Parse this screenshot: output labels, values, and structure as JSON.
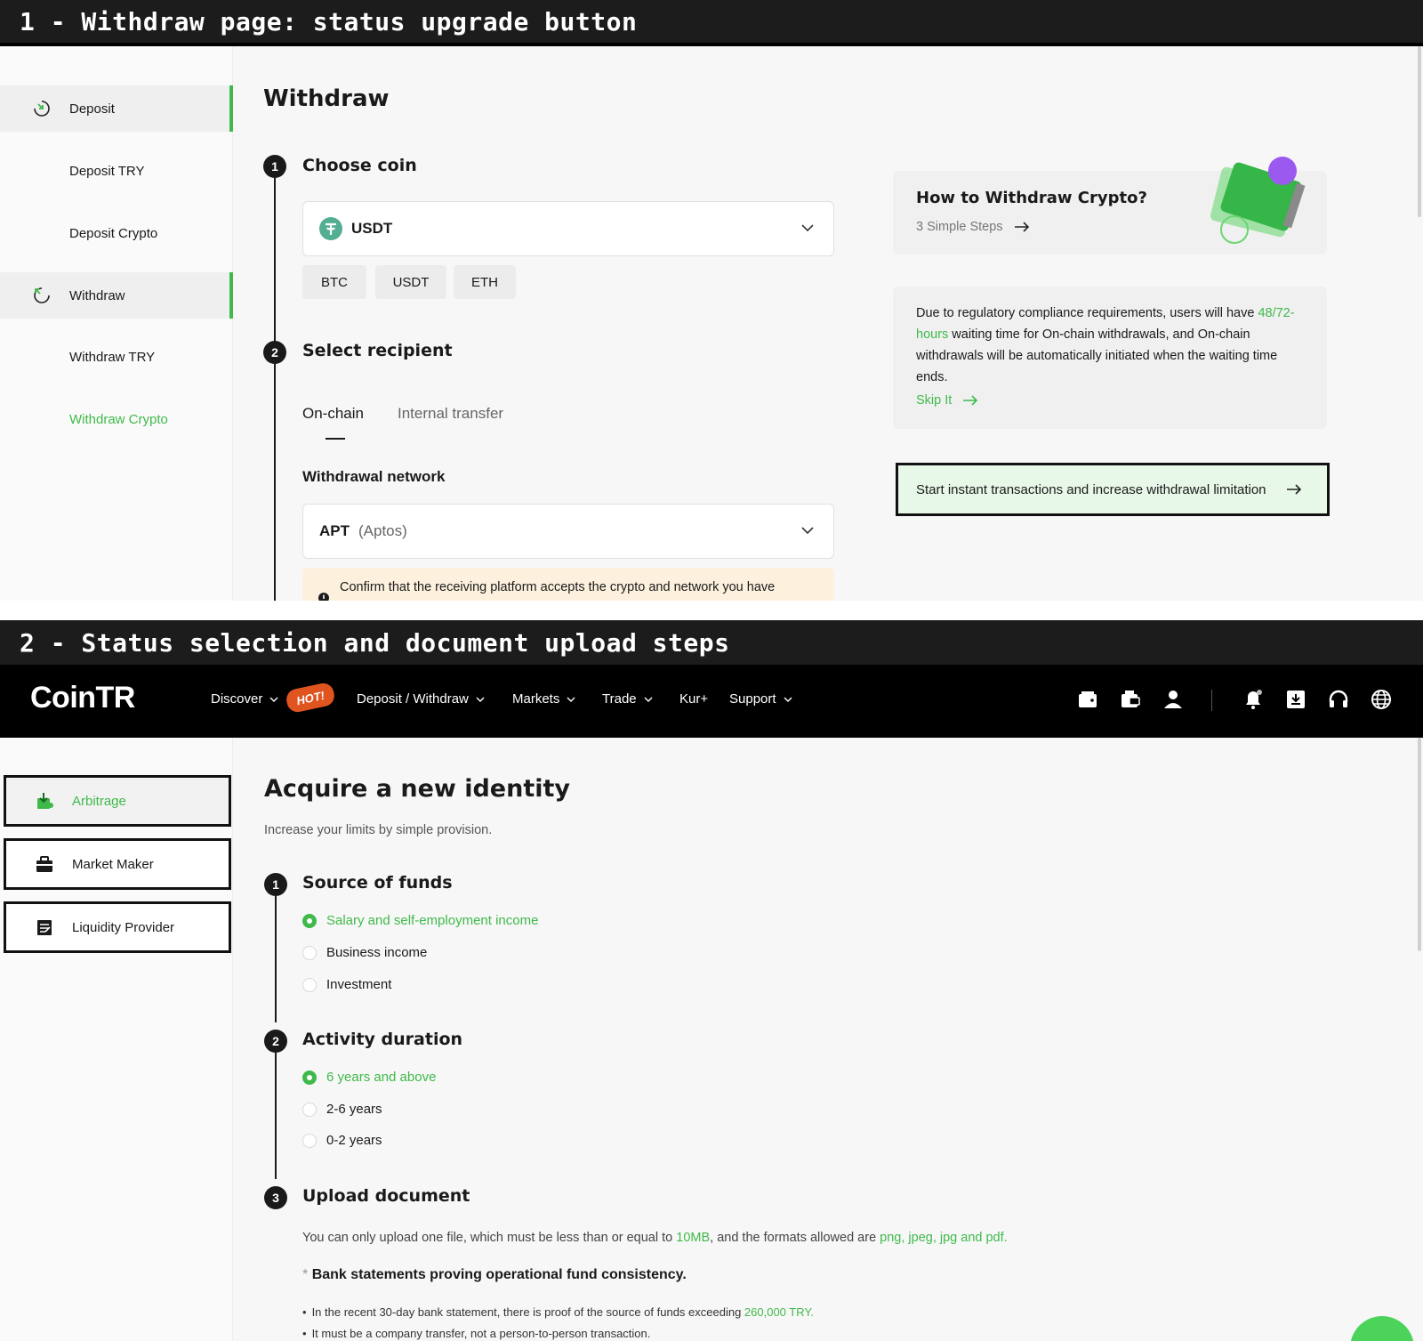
{
  "banners": {
    "one": "1 - Withdraw page: status upgrade button",
    "two": "2 - Status selection and document upload steps"
  },
  "withdraw_page": {
    "sidebar": {
      "deposit": "Deposit",
      "deposit_try": "Deposit TRY",
      "deposit_crypto": "Deposit Crypto",
      "withdraw": "Withdraw",
      "withdraw_try": "Withdraw TRY",
      "withdraw_crypto": "Withdraw Crypto"
    },
    "title": "Withdraw",
    "step1": {
      "num": "1",
      "label": "Choose coin",
      "selected_coin": "USDT",
      "chips": [
        "BTC",
        "USDT",
        "ETH"
      ]
    },
    "step2": {
      "num": "2",
      "label": "Select recipient",
      "tabs": [
        "On-chain",
        "Internal transfer"
      ],
      "network_label": "Withdrawal network",
      "network_code": "APT",
      "network_name": "(Aptos)",
      "notice": "Confirm that the receiving platform accepts the crypto and network you have"
    },
    "howto": {
      "title": "How to Withdraw Crypto?",
      "subtitle": "3 Simple Steps"
    },
    "compliance": {
      "part1": "Due to regulatory compliance requirements, users will have",
      "highlight": "48/72-hours",
      "part2": " waiting time for On-chain withdrawals, and On-chain withdrawals will be automatically initiated when the waiting time ends.",
      "link": "Skip It"
    },
    "promo_button": "Start instant transactions and increase withdrawal limitation"
  },
  "identity_page": {
    "nav": {
      "logo": "CoinTR",
      "discover": "Discover",
      "hot": "HOT!",
      "deposit_withdraw": "Deposit / Withdraw",
      "markets": "Markets",
      "trade": "Trade",
      "kur": "Kur+",
      "support": "Support"
    },
    "roles": [
      "Arbitrage",
      "Market Maker",
      "Liquidity Provider"
    ],
    "title": "Acquire a new identity",
    "subtitle": "Increase your limits by simple provision.",
    "source_of_funds": {
      "num": "1",
      "label": "Source of funds",
      "options": [
        "Salary and self-employment income",
        "Business income",
        "Investment"
      ],
      "selected": 0
    },
    "activity_duration": {
      "num": "2",
      "label": "Activity duration",
      "options": [
        "6 years and above",
        "2-6 years",
        "0-2 years"
      ],
      "selected": 0
    },
    "upload": {
      "num": "3",
      "label": "Upload document",
      "text_a": "You can only upload one file, which must be less than or equal to ",
      "size": "10MB",
      "text_b": ", and the formats allowed are ",
      "formats": "png, jpeg, jpg and pdf.",
      "star": "*",
      "requirement": "Bank statements proving operational fund consistency.",
      "bullet1_a": "In the recent 30-day bank statement, there is proof of the source of funds exceeding ",
      "bullet1_amount": "260,000 TRY.",
      "bullet2": "It must be a company transfer, not a person-to-person transaction."
    }
  },
  "colors": {
    "accent": "#3fba4a",
    "dark": "#1a1a1a",
    "banner": "#1c1c1c"
  }
}
